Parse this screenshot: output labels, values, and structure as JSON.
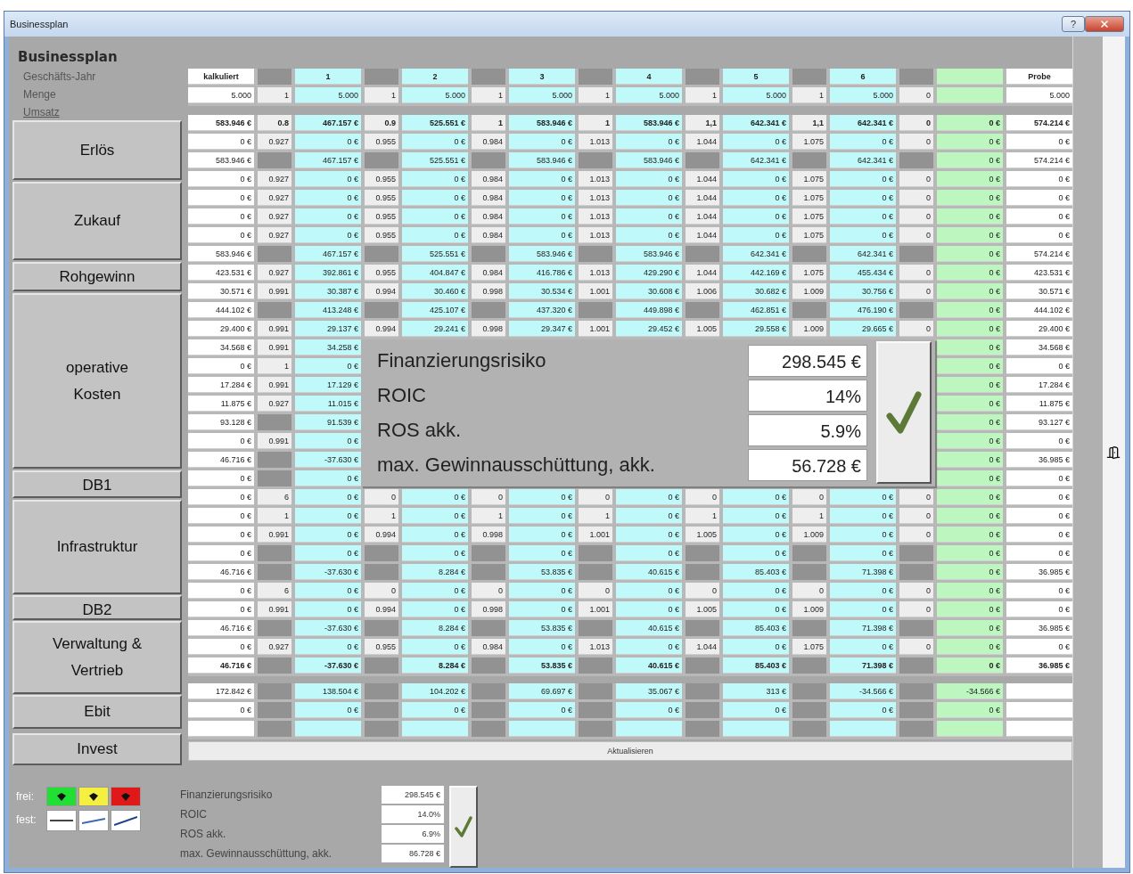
{
  "window": {
    "title": "Businessplan",
    "help_button": "?"
  },
  "sidebar": {
    "title": "Businessplan",
    "labels": [
      {
        "text": "Geschäfts-Jahr",
        "underlined": false
      },
      {
        "text": "Menge",
        "underlined": false
      },
      {
        "text": "Umsatz",
        "underlined": true
      }
    ],
    "buttons": [
      "Erlös",
      "Zukauf",
      "Rohgewinn",
      "operative\nKosten",
      "DB1",
      "Infrastruktur",
      "DB2",
      "Verwaltung &\nVertrieb",
      "Ebit",
      "Invest"
    ]
  },
  "table": {
    "sections": [
      {
        "rows": [
          {
            "kind": "header",
            "bold": true,
            "cells": [
              "kalkuliert",
              null,
              "1",
              null,
              "2",
              null,
              "3",
              null,
              "4",
              null,
              "5",
              null,
              "6",
              null,
              null,
              "Probe"
            ]
          },
          {
            "kind": "data",
            "bold": false,
            "cells": [
              "5.000",
              "1",
              "5.000",
              "1",
              "5.000",
              "1",
              "5.000",
              "1",
              "5.000",
              "1",
              "5.000",
              "1",
              "5.000",
              "0",
              null,
              "5.000"
            ]
          }
        ]
      },
      {
        "rows": [
          {
            "kind": "data",
            "bold": true,
            "cells": [
              "583.946 €",
              "0.8",
              "467.157 €",
              "0.9",
              "525.551 €",
              "1",
              "583.946 €",
              "1",
              "583.946 €",
              "1,1",
              "642.341 €",
              "1,1",
              "642.341 €",
              "0",
              "0 €",
              "574.214 €"
            ]
          },
          {
            "kind": "data",
            "bold": false,
            "cells": [
              "0 €",
              "0.927",
              "0 €",
              "0.955",
              "0 €",
              "0.984",
              "0 €",
              "1.013",
              "0 €",
              "1.044",
              "0 €",
              "1.075",
              "0 €",
              "0",
              "0 €",
              "0 €"
            ]
          },
          {
            "kind": "data",
            "bold": false,
            "cells": [
              "583.946 €",
              null,
              "467.157 €",
              null,
              "525.551 €",
              null,
              "583.946 €",
              null,
              "583.946 €",
              null,
              "642.341 €",
              null,
              "642.341 €",
              null,
              "0 €",
              "574.214 €"
            ]
          },
          {
            "kind": "data",
            "bold": false,
            "cells": [
              "0 €",
              "0.927",
              "0 €",
              "0.955",
              "0 €",
              "0.984",
              "0 €",
              "1.013",
              "0 €",
              "1.044",
              "0 €",
              "1.075",
              "0 €",
              "0",
              "0 €",
              "0 €"
            ]
          },
          {
            "kind": "data",
            "bold": false,
            "cells": [
              "0 €",
              "0.927",
              "0 €",
              "0.955",
              "0 €",
              "0.984",
              "0 €",
              "1.013",
              "0 €",
              "1.044",
              "0 €",
              "1.075",
              "0 €",
              "0",
              "0 €",
              "0 €"
            ]
          },
          {
            "kind": "data",
            "bold": false,
            "cells": [
              "0 €",
              "0.927",
              "0 €",
              "0.955",
              "0 €",
              "0.984",
              "0 €",
              "1.013",
              "0 €",
              "1.044",
              "0 €",
              "1.075",
              "0 €",
              "0",
              "0 €",
              "0 €"
            ]
          },
          {
            "kind": "data",
            "bold": false,
            "cells": [
              "0 €",
              "0.927",
              "0 €",
              "0.955",
              "0 €",
              "0.984",
              "0 €",
              "1.013",
              "0 €",
              "1.044",
              "0 €",
              "1.075",
              "0 €",
              "0",
              "0 €",
              "0 €"
            ]
          },
          {
            "kind": "data",
            "bold": false,
            "cells": [
              "583.946 €",
              null,
              "467.157 €",
              null,
              "525.551 €",
              null,
              "583.946 €",
              null,
              "583.946 €",
              null,
              "642.341 €",
              null,
              "642.341 €",
              null,
              "0 €",
              "574.214 €"
            ]
          },
          {
            "kind": "data",
            "bold": false,
            "cells": [
              "423.531 €",
              "0.927",
              "392.861 €",
              "0.955",
              "404.847 €",
              "0.984",
              "416.786 €",
              "1.013",
              "429.290 €",
              "1.044",
              "442.169 €",
              "1.075",
              "455.434 €",
              "0",
              "0 €",
              "423.531 €"
            ]
          },
          {
            "kind": "data",
            "bold": false,
            "cells": [
              "30.571 €",
              "0.991",
              "30.387 €",
              "0.994",
              "30.460 €",
              "0.998",
              "30.534 €",
              "1.001",
              "30.608 €",
              "1.006",
              "30.682 €",
              "1.009",
              "30.756 €",
              "0",
              "0 €",
              "30.571 €"
            ]
          },
          {
            "kind": "data",
            "bold": false,
            "cells": [
              "444.102 €",
              null,
              "413.248 €",
              null,
              "425.107 €",
              null,
              "437.320 €",
              null,
              "449.898 €",
              null,
              "462.851 €",
              null,
              "476.190 €",
              null,
              "0 €",
              "444.102 €"
            ]
          },
          {
            "kind": "data",
            "bold": false,
            "cells": [
              "29.400 €",
              "0.991",
              "29.137 €",
              "0.994",
              "29.241 €",
              "0.998",
              "29.347 €",
              "1.001",
              "29.452 €",
              "1.005",
              "29.558 €",
              "1.009",
              "29.665 €",
              "0",
              "0 €",
              "29.400 €"
            ]
          },
          {
            "kind": "data",
            "bold": false,
            "cells": [
              "34.568 €",
              "0.991",
              "34.258 €",
              null,
              null,
              null,
              null,
              null,
              null,
              null,
              null,
              null,
              null,
              null,
              "0 €",
              "34.568 €"
            ]
          },
          {
            "kind": "data",
            "bold": false,
            "cells": [
              "0 €",
              "1",
              "0 €",
              null,
              null,
              null,
              null,
              null,
              null,
              null,
              null,
              null,
              null,
              null,
              "0 €",
              "0 €"
            ]
          },
          {
            "kind": "data",
            "bold": false,
            "cells": [
              "17.284 €",
              "0.991",
              "17.129 €",
              null,
              null,
              null,
              null,
              null,
              null,
              null,
              null,
              null,
              null,
              null,
              "0 €",
              "17.284 €"
            ]
          },
          {
            "kind": "data",
            "bold": false,
            "cells": [
              "11.875 €",
              "0.927",
              "11.015 €",
              null,
              null,
              null,
              null,
              null,
              null,
              null,
              null,
              null,
              null,
              null,
              "0 €",
              "11.875 €"
            ]
          },
          {
            "kind": "data",
            "bold": false,
            "cells": [
              "93.128 €",
              null,
              "91.539 €",
              null,
              null,
              null,
              null,
              null,
              null,
              null,
              null,
              null,
              null,
              null,
              "0 €",
              "93.127 €"
            ]
          },
          {
            "kind": "data",
            "bold": false,
            "cells": [
              "0 €",
              "0.991",
              "0 €",
              null,
              null,
              null,
              null,
              null,
              null,
              null,
              null,
              null,
              null,
              null,
              "0 €",
              "0 €"
            ]
          },
          {
            "kind": "data",
            "bold": false,
            "cells": [
              "46.716 €",
              null,
              "-37.630 €",
              null,
              null,
              null,
              null,
              null,
              null,
              null,
              null,
              null,
              null,
              null,
              "0 €",
              "36.985 €"
            ]
          },
          {
            "kind": "data",
            "bold": false,
            "cells": [
              "0 €",
              null,
              "0 €",
              null,
              null,
              null,
              null,
              null,
              null,
              null,
              null,
              null,
              null,
              null,
              "0 €",
              "0 €"
            ]
          },
          {
            "kind": "data",
            "bold": false,
            "cells": [
              "0 €",
              "6",
              "0 €",
              "0",
              "0 €",
              "0",
              "0 €",
              "0",
              "0 €",
              "0",
              "0 €",
              "0",
              "0 €",
              "0",
              "0 €",
              "0 €"
            ]
          },
          {
            "kind": "data",
            "bold": false,
            "cells": [
              "0 €",
              "1",
              "0 €",
              "1",
              "0 €",
              "1",
              "0 €",
              "1",
              "0 €",
              "1",
              "0 €",
              "1",
              "0 €",
              "0",
              "0 €",
              "0 €"
            ]
          },
          {
            "kind": "data",
            "bold": false,
            "cells": [
              "0 €",
              "0.991",
              "0 €",
              "0.994",
              "0 €",
              "0.998",
              "0 €",
              "1.001",
              "0 €",
              "1.005",
              "0 €",
              "1.009",
              "0 €",
              "0",
              "0 €",
              "0 €"
            ]
          },
          {
            "kind": "data",
            "bold": false,
            "cells": [
              "0 €",
              null,
              "0 €",
              null,
              "0 €",
              null,
              "0 €",
              null,
              "0 €",
              null,
              "0 €",
              null,
              "0 €",
              null,
              "0 €",
              "0 €"
            ]
          },
          {
            "kind": "data",
            "bold": false,
            "cells": [
              "46.716 €",
              null,
              "-37.630 €",
              null,
              "8.284 €",
              null,
              "53.835 €",
              null,
              "40.615 €",
              null,
              "85.403 €",
              null,
              "71.398 €",
              null,
              "0 €",
              "36.985 €"
            ]
          },
          {
            "kind": "data",
            "bold": false,
            "cells": [
              "0 €",
              "6",
              "0 €",
              "0",
              "0 €",
              "0",
              "0 €",
              "0",
              "0 €",
              "0",
              "0 €",
              "0",
              "0 €",
              "0",
              "0 €",
              "0 €"
            ]
          },
          {
            "kind": "data",
            "bold": false,
            "cells": [
              "0 €",
              "0.991",
              "0 €",
              "0.994",
              "0 €",
              "0.998",
              "0 €",
              "1.001",
              "0 €",
              "1.005",
              "0 €",
              "1.009",
              "0 €",
              "0",
              "0 €",
              "0 €"
            ]
          },
          {
            "kind": "data",
            "bold": false,
            "cells": [
              "46.716 €",
              null,
              "-37.630 €",
              null,
              "8.284 €",
              null,
              "53.835 €",
              null,
              "40.615 €",
              null,
              "85.403 €",
              null,
              "71.398 €",
              null,
              "0 €",
              "36.985 €"
            ]
          },
          {
            "kind": "data",
            "bold": false,
            "cells": [
              "0 €",
              "0.927",
              "0 €",
              "0.955",
              "0 €",
              "0.984",
              "0 €",
              "1.013",
              "0 €",
              "1.044",
              "0 €",
              "1.075",
              "0 €",
              "0",
              "0 €",
              "0 €"
            ]
          },
          {
            "kind": "data",
            "bold": true,
            "cells": [
              "46.716 €",
              null,
              "-37.630 €",
              null,
              "8.284 €",
              null,
              "53.835 €",
              null,
              "40.615 €",
              null,
              "85.403 €",
              null,
              "71.398 €",
              null,
              "0 €",
              "36.985 €"
            ]
          }
        ]
      },
      {
        "rows": [
          {
            "kind": "data",
            "bold": false,
            "cells": [
              "172.842 €",
              null,
              "138.504 €",
              null,
              "104.202 €",
              null,
              "69.697 €",
              null,
              "35.067 €",
              null,
              "313 €",
              null,
              "-34.566 €",
              null,
              "-34.566 €",
              null
            ]
          },
          {
            "kind": "data",
            "bold": false,
            "cells": [
              "0 €",
              null,
              "0 €",
              null,
              "0 €",
              null,
              "0 €",
              null,
              "0 €",
              null,
              "0 €",
              null,
              "0 €",
              null,
              "0 €",
              null
            ]
          },
          {
            "kind": "data",
            "cells": [
              null,
              null,
              null,
              null,
              null,
              null,
              null,
              null,
              null,
              null,
              null,
              null,
              null,
              null,
              null,
              null
            ]
          }
        ]
      }
    ]
  },
  "update_button": "Aktualisieren",
  "legend": {
    "frei": {
      "label": "frei:",
      "swatches": [
        {
          "color": "#22e033"
        },
        {
          "color": "#f5f040"
        },
        {
          "color": "#e01818"
        }
      ]
    },
    "fest": {
      "label": "fest:",
      "styles": [
        {
          "kind": "flat"
        },
        {
          "kind": "gentle"
        },
        {
          "kind": "steep"
        }
      ]
    }
  },
  "summary": {
    "metrics": [
      {
        "label": "Finanzierungsrisiko",
        "value": "298.545 €"
      },
      {
        "label": "ROIC",
        "value": "14.0%"
      },
      {
        "label": "ROS akk.",
        "value": "6.9%"
      },
      {
        "label": "max. Gewinnausschüttung, akk.",
        "value": "86.728 €"
      }
    ]
  },
  "popup": {
    "metrics": [
      {
        "label": "Finanzierungsrisiko",
        "value": "298.545 €"
      },
      {
        "label": "ROIC",
        "value": "14%"
      },
      {
        "label": "ROS akk.",
        "value": "5.9%"
      },
      {
        "label": "max. Gewinnausschüttung, akk.",
        "value": "56.728 €"
      }
    ]
  }
}
